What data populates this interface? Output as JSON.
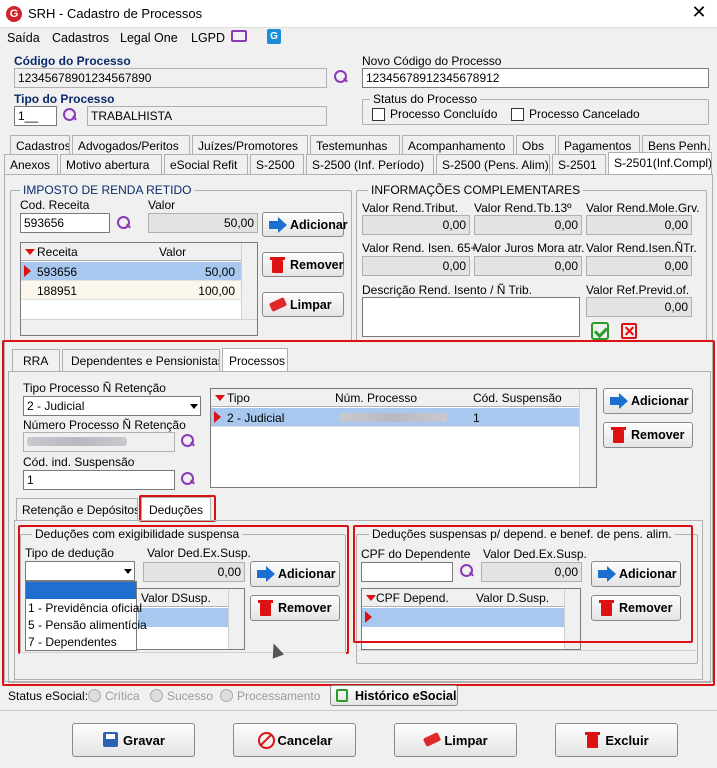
{
  "window": {
    "title": "SRH - Cadastro de Processos",
    "close": "✕"
  },
  "menu": [
    "Saída",
    "Cadastros",
    "Legal One",
    "LGPD"
  ],
  "header": {
    "codigo_label": "Código do Processo",
    "codigo_value": "12345678901234567890",
    "novo_codigo_label": "Novo Código do Processo",
    "novo_codigo_value": "12345678912345678912",
    "tipo_label": "Tipo do Processo",
    "tipo_code": "1__",
    "tipo_desc": "TRABALHISTA",
    "status_label": "Status do Processo",
    "status_concluido": "Processo Concluído",
    "status_cancelado": "Processo Cancelado"
  },
  "tabs_row1": [
    "Cadastros",
    "Advogados/Peritos",
    "Juízes/Promotores",
    "Testemunhas",
    "Acompanhamento",
    "Obs",
    "Pagamentos",
    "Bens Penh."
  ],
  "tabs_row2": [
    "Anexos",
    "Motivo abertura",
    "eSocial Refit",
    "S-2500",
    "S-2500 (Inf. Período)",
    "S-2500 (Pens. Alim)",
    "S-2501",
    "S-2501(Inf.Compl)"
  ],
  "irrf": {
    "title": "IMPOSTO DE RENDA RETIDO",
    "cod_receita_label": "Cod. Receita",
    "cod_receita_value": "593656",
    "valor_label": "Valor",
    "valor_value": "50,00",
    "grid_headers": [
      "Receita",
      "Valor"
    ],
    "rows": [
      {
        "receita": "593656",
        "valor": "50,00"
      },
      {
        "receita": "188951",
        "valor": "100,00"
      }
    ],
    "btn_adicionar": "Adicionar",
    "btn_remover": "Remover",
    "btn_limpar": "Limpar"
  },
  "info": {
    "title": "INFORMAÇÕES COMPLEMENTARES",
    "row1_labels": [
      "Valor Rend.Tribut.",
      "Valor Rend.Tb.13º",
      "Valor Rend.Mole.Grv."
    ],
    "row1_values": [
      "0,00",
      "0,00",
      "0,00"
    ],
    "row2_labels": [
      "Valor Rend. Isen. 65+",
      "Valor Juros Mora atr.",
      "Valor Rend.Isen.ÑTr."
    ],
    "row2_values": [
      "0,00",
      "0,00",
      "0,00"
    ],
    "descricao_label": "Descrição Rend. Isento / Ñ Trib.",
    "previd_label": "Valor Ref.Previd.of.",
    "previd_value": "0,00"
  },
  "subtabs": [
    "RRA",
    "Dependentes e Pensionistas",
    "Processos"
  ],
  "processos": {
    "tipo_label": "Tipo Processo Ñ Retenção",
    "tipo_value": "2 - Judicial",
    "numero_label": "Número Processo Ñ Retenção",
    "cod_label": "Cód. ind. Suspensão",
    "cod_value": "1",
    "grid_headers": [
      "Tipo",
      "Núm. Processo",
      "Cód. Suspensão"
    ],
    "row": {
      "tipo": "2 - Judicial",
      "cod": "1"
    },
    "btn_adicionar": "Adicionar",
    "btn_remover": "Remover"
  },
  "inner_tabs": [
    "Retenção e Depósitos",
    "Deduções"
  ],
  "deducoes": {
    "title": "Deduções com exigibilidade suspensa",
    "tipo_label": "Tipo de dedução",
    "valor_label": "Valor Ded.Ex.Susp.",
    "valor_value": "0,00",
    "options": [
      "1 - Previdência oficial",
      "5 - Pensão alimentícia",
      "7 - Dependentes"
    ],
    "grid_header": "Valor DSusp.",
    "btn_adicionar": "Adicionar",
    "btn_remover": "Remover"
  },
  "suspensas": {
    "title": "Deduções suspensas p/ depend. e benef. de pens. alim.",
    "cpf_label": "CPF do Dependente",
    "valor_label": "Valor Ded.Ex.Susp.",
    "valor_value": "0,00",
    "grid_headers": [
      "CPF Depend.",
      "Valor D.Susp."
    ],
    "btn_adicionar": "Adicionar",
    "btn_remover": "Remover"
  },
  "status": {
    "label": "Status eSocial:",
    "critica": "Crítica",
    "sucesso": "Sucesso",
    "processamento": "Processamento",
    "historico": "Histórico eSocial"
  },
  "bottom": {
    "gravar": "Gravar",
    "cancelar": "Cancelar",
    "limpar": "Limpar",
    "excluir": "Excluir"
  }
}
